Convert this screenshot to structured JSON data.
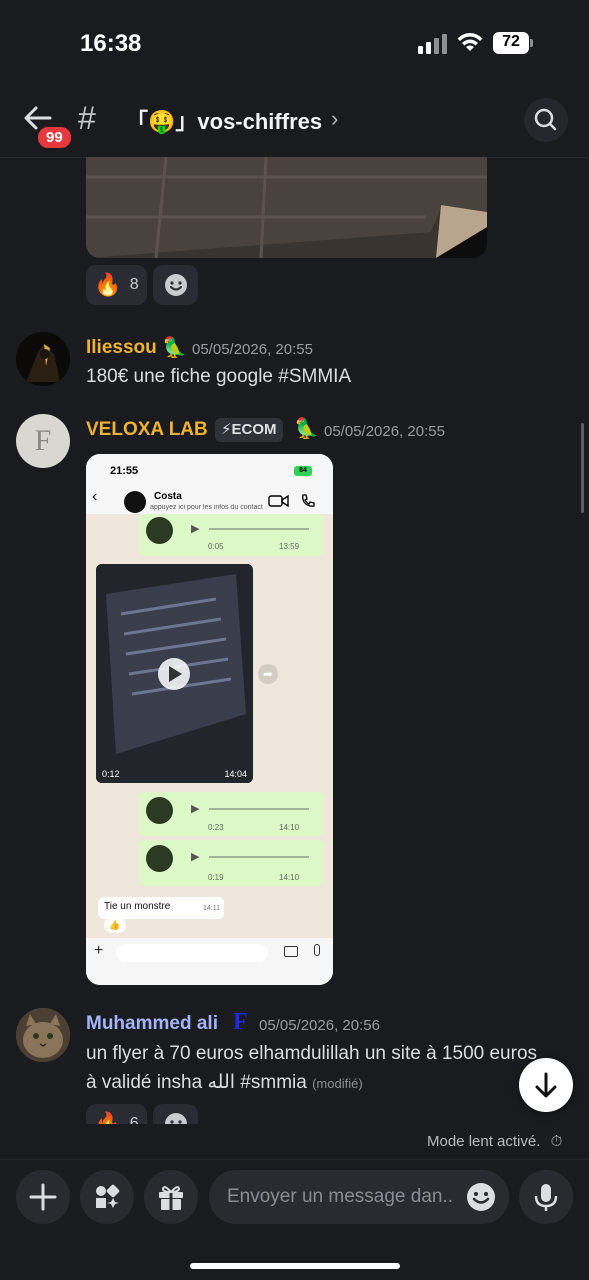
{
  "status_bar": {
    "time": "16:38",
    "battery": "72"
  },
  "header": {
    "back_badge": "99",
    "channel_name": "「🤑」vos-chiffres",
    "chevron": "›"
  },
  "reactions_top": {
    "fire_emoji": "🔥",
    "fire_count": "8"
  },
  "messages": [
    {
      "author": "Iliessou",
      "author_color": "#f0b232",
      "badge_emoji": "🦜",
      "timestamp": "05/05/2026, 20:55",
      "text": "180€ une fiche google #SMMIA"
    },
    {
      "author": "VELOXA LAB",
      "author_color": "#f0b232",
      "tag": "⚡ECOM",
      "badge_emoji": "🦜",
      "timestamp": "05/05/2026, 20:55",
      "avatar_letter": "F"
    },
    {
      "author": "Muhammed ali",
      "author_color": "#a4b4ff",
      "badge_glyph": "F",
      "timestamp": "05/05/2026, 20:56",
      "text_line1": "un flyer à 70 euros elhamdulillah un site à 1500 euros",
      "text_line2": "à validé insha الله #smmia",
      "modified": "(modifié)",
      "reaction_count": "6"
    }
  ],
  "embedded_screenshot": {
    "time": "21:55",
    "battery": "84",
    "contact_name": "Costa",
    "contact_sub": "appuyez ici pour les infos du contact",
    "voice1": {
      "duration": "0:05",
      "time": "13:59"
    },
    "video": {
      "duration": "0:12",
      "time": "14:04"
    },
    "voice2": {
      "duration": "0:23",
      "time": "14:10"
    },
    "voice3": {
      "duration": "0:19",
      "time": "14:10"
    },
    "text_message": "Tie un monstre",
    "text_time": "14:11",
    "reaction": "👍"
  },
  "slow_mode": "Mode lent activé.",
  "composer": {
    "placeholder": "Envoyer un message dan.."
  },
  "colors": {
    "background": "#1a1b1f",
    "accent_red": "#e7373f",
    "bubble_green": "#dcf8c6"
  }
}
